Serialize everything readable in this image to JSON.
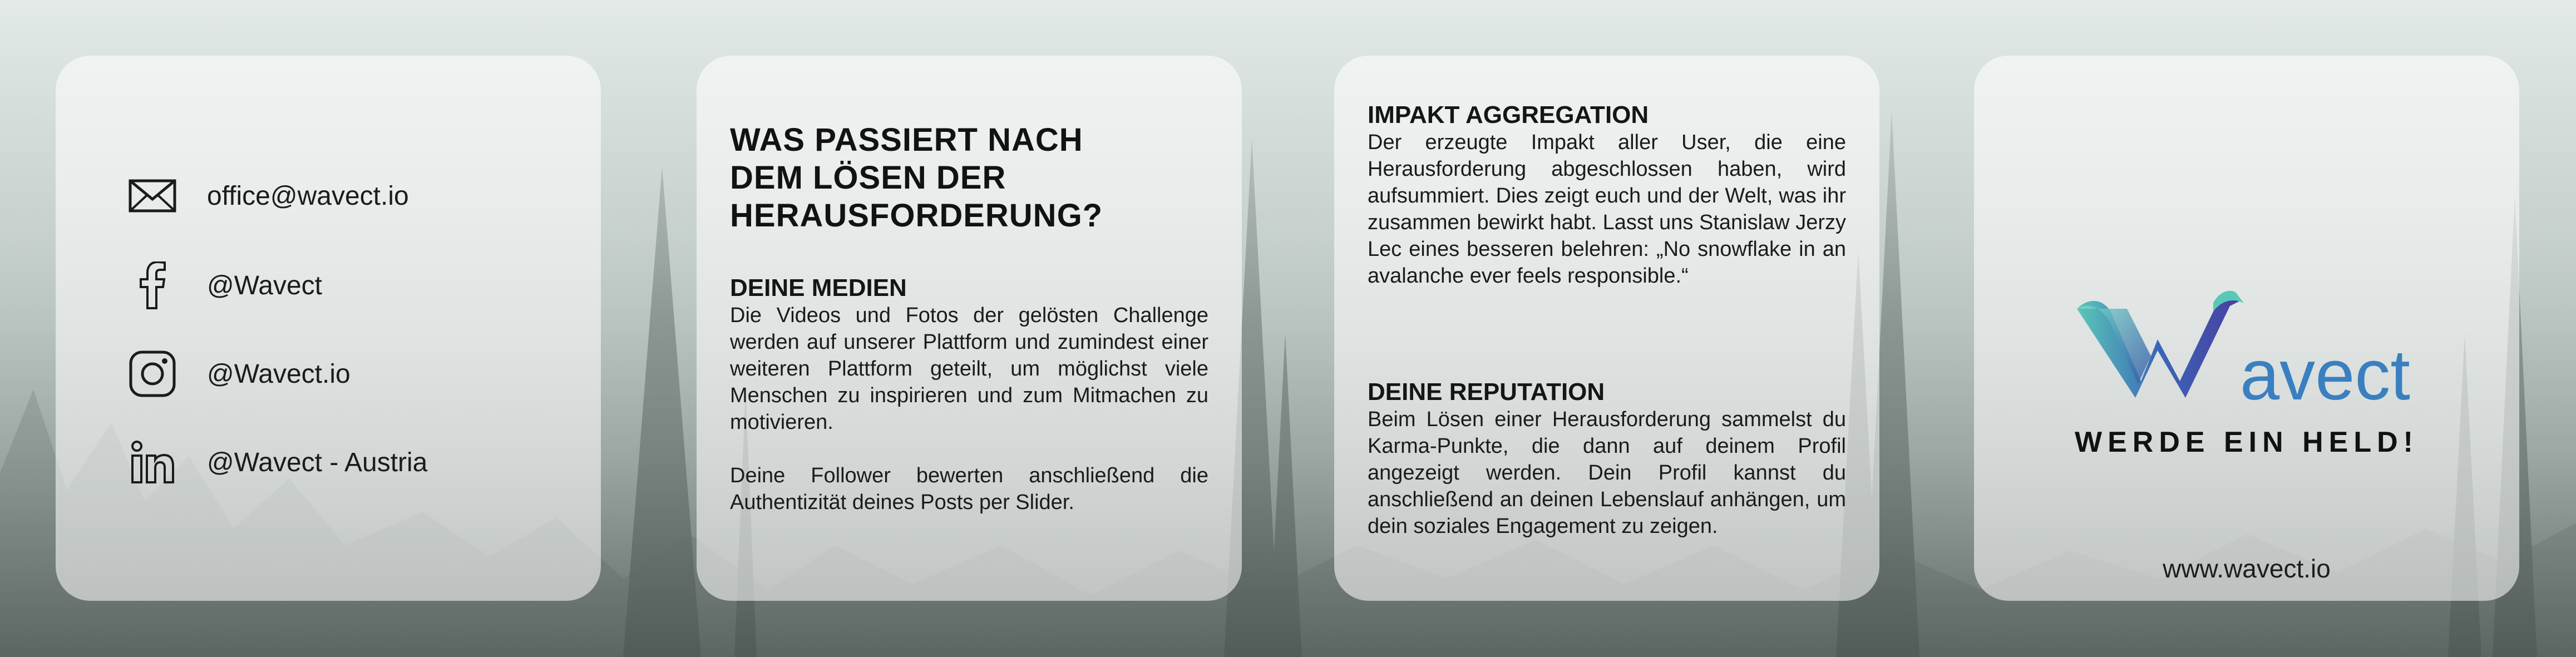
{
  "colors": {
    "brand_teal": "#5ac8b7",
    "brand_blue": "#3a66b8",
    "brand_purple": "#4a3fa0",
    "text": "#1a1a1a"
  },
  "contact": {
    "items": [
      {
        "icon": "envelope-icon",
        "label": "office@wavect.io"
      },
      {
        "icon": "facebook-icon",
        "label": "@Wavect"
      },
      {
        "icon": "instagram-icon",
        "label": "@Wavect.io"
      },
      {
        "icon": "linkedin-icon",
        "label": "@Wavect - Austria"
      }
    ]
  },
  "panel2": {
    "heading": "WAS PASSIERT NACH DEM LÖSEN DER HERAUSFORDERUNG?",
    "section_title": "DEINE MEDIEN",
    "paragraph1": "Die Videos und Fotos der gelösten Challenge werden auf unserer Plattform und zumindest einer weiteren Plattform geteilt, um möglichst viele Menschen zu inspirieren und zum Mitmachen zu motivieren.",
    "paragraph2": "Deine Follower bewerten anschließend die Authentizität deines Posts per Slider."
  },
  "panel3": {
    "section1_title": "IMPAKT AGGREGATION",
    "section1_text": "Der erzeugte Impakt aller User, die eine Herausforderung abgeschlossen haben, wird aufsummiert. Dies zeigt euch und der Welt, was ihr zusammen bewirkt habt. Lasst uns Stanislaw Jerzy Lec eines besseren belehren: „No snowflake in an avalanche ever feels responsible.“",
    "section2_title": "DEINE REPUTATION",
    "section2_text": "Beim Lösen einer Herausforderung sammelst du Karma-Punkte, die dann auf deinem Profil angezeigt werden. Dein Profil kannst du anschließend an deinen Lebenslauf anhängen, um dein soziales Engagement zu zeigen."
  },
  "panel4": {
    "logo_text": "avect",
    "slogan": "WERDE EIN HELD!",
    "website": "www.wavect.io"
  }
}
